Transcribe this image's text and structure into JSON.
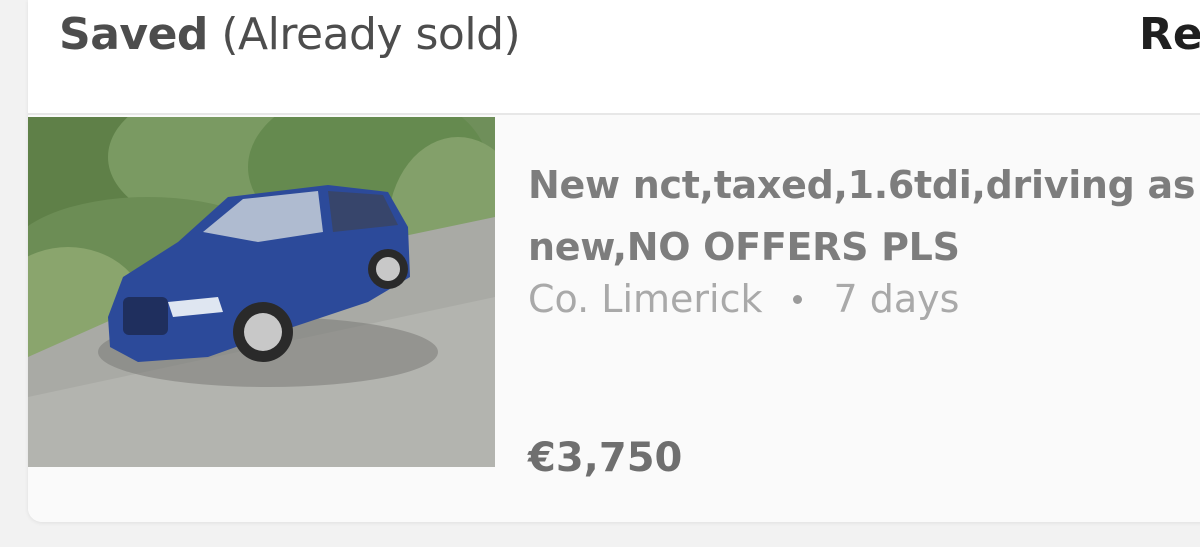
{
  "header": {
    "title_bold": "Saved",
    "title_rest": " (Already sold)",
    "right_partial": "Re"
  },
  "listing": {
    "title": "New nct,taxed,1.6tdi,driving as new,NO OFFERS PLS",
    "location": "Co. Limerick",
    "age": "7 days",
    "price": "€3,750",
    "thumbnail": "blue-hatchback-car-photo"
  },
  "colors": {
    "page_bg": "#f2f2f2",
    "card_bg": "#ffffff",
    "header_text": "#4d4d4d",
    "listing_title": "#7d7d7d",
    "meta_text": "#a9a9a9",
    "price_text": "#6f6f6f"
  }
}
